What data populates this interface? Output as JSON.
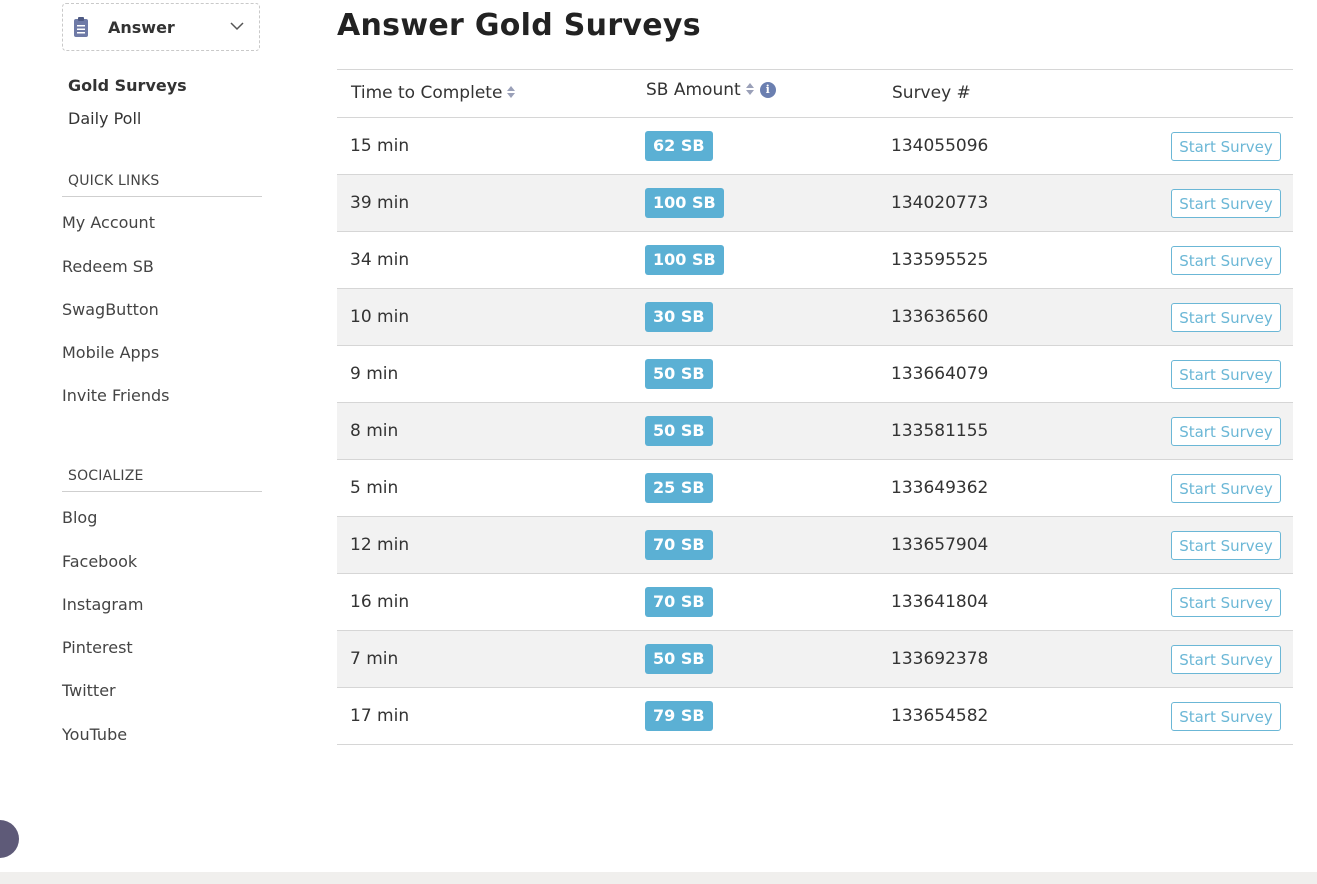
{
  "sidebar": {
    "dropdown_label": "Answer",
    "sub_items": [
      "Gold Surveys",
      "Daily Poll"
    ],
    "quick_links_heading": "QUICK LINKS",
    "quick_links": [
      "My Account",
      "Redeem SB",
      "SwagButton",
      "Mobile Apps",
      "Invite Friends"
    ],
    "socialize_heading": "SOCIALIZE",
    "social_links": [
      "Blog",
      "Facebook",
      "Instagram",
      "Pinterest",
      "Twitter",
      "YouTube"
    ]
  },
  "main": {
    "title": "Answer Gold Surveys",
    "columns": [
      "Time to Complete",
      "SB Amount",
      "Survey #"
    ],
    "button_label": "Start Survey",
    "rows": [
      {
        "time": "15 min",
        "sb": "62 SB",
        "survey": "134055096"
      },
      {
        "time": "39 min",
        "sb": "100 SB",
        "survey": "134020773"
      },
      {
        "time": "34 min",
        "sb": "100 SB",
        "survey": "133595525"
      },
      {
        "time": "10 min",
        "sb": "30 SB",
        "survey": "133636560"
      },
      {
        "time": "9 min",
        "sb": "50 SB",
        "survey": "133664079"
      },
      {
        "time": "8 min",
        "sb": "50 SB",
        "survey": "133581155"
      },
      {
        "time": "5 min",
        "sb": "25 SB",
        "survey": "133649362"
      },
      {
        "time": "12 min",
        "sb": "70 SB",
        "survey": "133657904"
      },
      {
        "time": "16 min",
        "sb": "70 SB",
        "survey": "133641804"
      },
      {
        "time": "7 min",
        "sb": "50 SB",
        "survey": "133692378"
      },
      {
        "time": "17 min",
        "sb": "79 SB",
        "survey": "133654582"
      }
    ]
  },
  "colors": {
    "badge": "#5bb0d4",
    "button_border": "#6bb7d6",
    "alt_row": "#f2f2f2"
  },
  "icons": [
    "clipboard-icon",
    "chevron-down-icon",
    "sort-icon",
    "info-icon",
    "accessibility-icon"
  ]
}
